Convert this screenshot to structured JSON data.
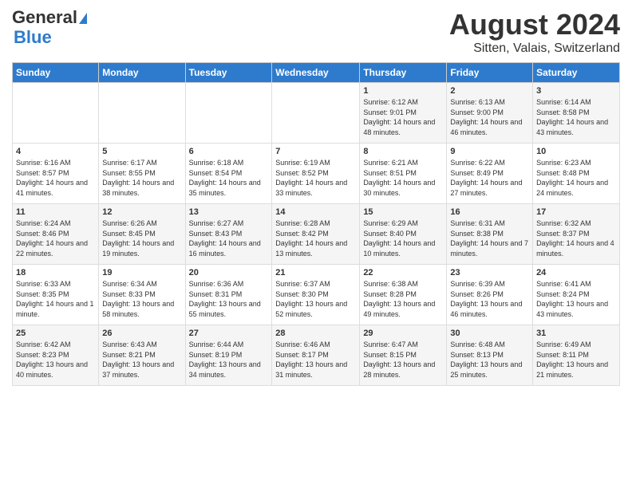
{
  "logo": {
    "line1": "General",
    "line2": "Blue"
  },
  "title": "August 2024",
  "subtitle": "Sitten, Valais, Switzerland",
  "days_of_week": [
    "Sunday",
    "Monday",
    "Tuesday",
    "Wednesday",
    "Thursday",
    "Friday",
    "Saturday"
  ],
  "weeks": [
    [
      {
        "day": "",
        "info": ""
      },
      {
        "day": "",
        "info": ""
      },
      {
        "day": "",
        "info": ""
      },
      {
        "day": "",
        "info": ""
      },
      {
        "day": "1",
        "info": "Sunrise: 6:12 AM\nSunset: 9:01 PM\nDaylight: 14 hours and 48 minutes."
      },
      {
        "day": "2",
        "info": "Sunrise: 6:13 AM\nSunset: 9:00 PM\nDaylight: 14 hours and 46 minutes."
      },
      {
        "day": "3",
        "info": "Sunrise: 6:14 AM\nSunset: 8:58 PM\nDaylight: 14 hours and 43 minutes."
      }
    ],
    [
      {
        "day": "4",
        "info": "Sunrise: 6:16 AM\nSunset: 8:57 PM\nDaylight: 14 hours and 41 minutes."
      },
      {
        "day": "5",
        "info": "Sunrise: 6:17 AM\nSunset: 8:55 PM\nDaylight: 14 hours and 38 minutes."
      },
      {
        "day": "6",
        "info": "Sunrise: 6:18 AM\nSunset: 8:54 PM\nDaylight: 14 hours and 35 minutes."
      },
      {
        "day": "7",
        "info": "Sunrise: 6:19 AM\nSunset: 8:52 PM\nDaylight: 14 hours and 33 minutes."
      },
      {
        "day": "8",
        "info": "Sunrise: 6:21 AM\nSunset: 8:51 PM\nDaylight: 14 hours and 30 minutes."
      },
      {
        "day": "9",
        "info": "Sunrise: 6:22 AM\nSunset: 8:49 PM\nDaylight: 14 hours and 27 minutes."
      },
      {
        "day": "10",
        "info": "Sunrise: 6:23 AM\nSunset: 8:48 PM\nDaylight: 14 hours and 24 minutes."
      }
    ],
    [
      {
        "day": "11",
        "info": "Sunrise: 6:24 AM\nSunset: 8:46 PM\nDaylight: 14 hours and 22 minutes."
      },
      {
        "day": "12",
        "info": "Sunrise: 6:26 AM\nSunset: 8:45 PM\nDaylight: 14 hours and 19 minutes."
      },
      {
        "day": "13",
        "info": "Sunrise: 6:27 AM\nSunset: 8:43 PM\nDaylight: 14 hours and 16 minutes."
      },
      {
        "day": "14",
        "info": "Sunrise: 6:28 AM\nSunset: 8:42 PM\nDaylight: 14 hours and 13 minutes."
      },
      {
        "day": "15",
        "info": "Sunrise: 6:29 AM\nSunset: 8:40 PM\nDaylight: 14 hours and 10 minutes."
      },
      {
        "day": "16",
        "info": "Sunrise: 6:31 AM\nSunset: 8:38 PM\nDaylight: 14 hours and 7 minutes."
      },
      {
        "day": "17",
        "info": "Sunrise: 6:32 AM\nSunset: 8:37 PM\nDaylight: 14 hours and 4 minutes."
      }
    ],
    [
      {
        "day": "18",
        "info": "Sunrise: 6:33 AM\nSunset: 8:35 PM\nDaylight: 14 hours and 1 minute."
      },
      {
        "day": "19",
        "info": "Sunrise: 6:34 AM\nSunset: 8:33 PM\nDaylight: 13 hours and 58 minutes."
      },
      {
        "day": "20",
        "info": "Sunrise: 6:36 AM\nSunset: 8:31 PM\nDaylight: 13 hours and 55 minutes."
      },
      {
        "day": "21",
        "info": "Sunrise: 6:37 AM\nSunset: 8:30 PM\nDaylight: 13 hours and 52 minutes."
      },
      {
        "day": "22",
        "info": "Sunrise: 6:38 AM\nSunset: 8:28 PM\nDaylight: 13 hours and 49 minutes."
      },
      {
        "day": "23",
        "info": "Sunrise: 6:39 AM\nSunset: 8:26 PM\nDaylight: 13 hours and 46 minutes."
      },
      {
        "day": "24",
        "info": "Sunrise: 6:41 AM\nSunset: 8:24 PM\nDaylight: 13 hours and 43 minutes."
      }
    ],
    [
      {
        "day": "25",
        "info": "Sunrise: 6:42 AM\nSunset: 8:23 PM\nDaylight: 13 hours and 40 minutes."
      },
      {
        "day": "26",
        "info": "Sunrise: 6:43 AM\nSunset: 8:21 PM\nDaylight: 13 hours and 37 minutes."
      },
      {
        "day": "27",
        "info": "Sunrise: 6:44 AM\nSunset: 8:19 PM\nDaylight: 13 hours and 34 minutes."
      },
      {
        "day": "28",
        "info": "Sunrise: 6:46 AM\nSunset: 8:17 PM\nDaylight: 13 hours and 31 minutes."
      },
      {
        "day": "29",
        "info": "Sunrise: 6:47 AM\nSunset: 8:15 PM\nDaylight: 13 hours and 28 minutes."
      },
      {
        "day": "30",
        "info": "Sunrise: 6:48 AM\nSunset: 8:13 PM\nDaylight: 13 hours and 25 minutes."
      },
      {
        "day": "31",
        "info": "Sunrise: 6:49 AM\nSunset: 8:11 PM\nDaylight: 13 hours and 21 minutes."
      }
    ]
  ]
}
